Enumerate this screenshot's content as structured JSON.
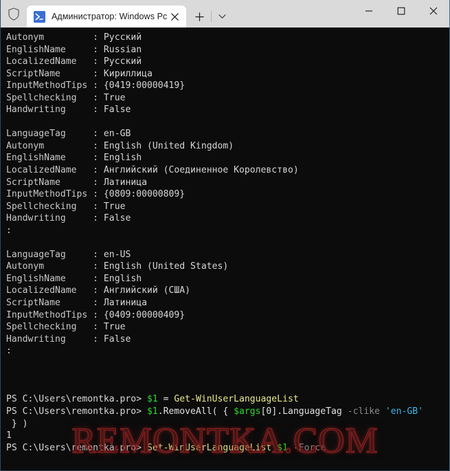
{
  "window": {
    "shield_icon": "shield-icon",
    "controls": {
      "minimize": "–",
      "maximize": "□",
      "close": "✕"
    },
    "accent_border": "#3d6b8e"
  },
  "tabbar": {
    "tab": {
      "icon": "powershell-icon",
      "title": "Администратор: Windows Pc",
      "close_label": "✕"
    },
    "new_tab_label": "+",
    "dropdown_label": "∨"
  },
  "terminal": {
    "background": "#0c0c0c",
    "foreground": "#cccccc",
    "colors": {
      "variable_green": "#2bd92b",
      "command_yellow": "#e8e88c",
      "string_blue": "#3ab7e8",
      "param_gray": "#8b8b8b"
    },
    "output_blocks": [
      {
        "rows": [
          {
            "key": "Autonym",
            "value": "Русский"
          },
          {
            "key": "EnglishName",
            "value": "Russian"
          },
          {
            "key": "LocalizedName",
            "value": "Русский"
          },
          {
            "key": "ScriptName",
            "value": "Кириллица"
          },
          {
            "key": "InputMethodTips",
            "value": "{0419:00000419}"
          },
          {
            "key": "Spellchecking",
            "value": "True"
          },
          {
            "key": "Handwriting",
            "value": "False"
          }
        ]
      },
      {
        "rows": [
          {
            "key": "LanguageTag",
            "value": "en-GB"
          },
          {
            "key": "Autonym",
            "value": "English (United Kingdom)"
          },
          {
            "key": "EnglishName",
            "value": "English"
          },
          {
            "key": "LocalizedName",
            "value": "Английский (Соединенное Королевство)"
          },
          {
            "key": "ScriptName",
            "value": "Латиница"
          },
          {
            "key": "InputMethodTips",
            "value": "{0809:00000809}"
          },
          {
            "key": "Spellchecking",
            "value": "True"
          },
          {
            "key": "Handwriting",
            "value": "False"
          }
        ]
      },
      {
        "rows": [
          {
            "key": "LanguageTag",
            "value": "en-US"
          },
          {
            "key": "Autonym",
            "value": "English (United States)"
          },
          {
            "key": "EnglishName",
            "value": "English"
          },
          {
            "key": "LocalizedName",
            "value": "Английский (США)"
          },
          {
            "key": "ScriptName",
            "value": "Латиница"
          },
          {
            "key": "InputMethodTips",
            "value": "{0409:00000409}"
          },
          {
            "key": "Spellchecking",
            "value": "True"
          },
          {
            "key": "Handwriting",
            "value": "False"
          }
        ]
      }
    ],
    "prompt": "PS C:\\Users\\remontka.pro>",
    "commands": {
      "line1": {
        "var": "$1",
        "equals": " = ",
        "cmdlet": "Get-WinUserLanguageList"
      },
      "line2": {
        "var": "$1",
        "method": ".RemoveAll( { ",
        "args_var": "$args",
        "index": "[0].LanguageTag ",
        "operator": "-clike",
        "string": "'en-GB'",
        "continuation": " } )"
      },
      "result": "1",
      "line3": {
        "cmdlet": "Set-WinUserLanguageList",
        "var": "$1",
        "param": "-Force"
      }
    }
  },
  "watermark": {
    "text": "REMONTKA.COM",
    "color": "#7d1d1d"
  }
}
